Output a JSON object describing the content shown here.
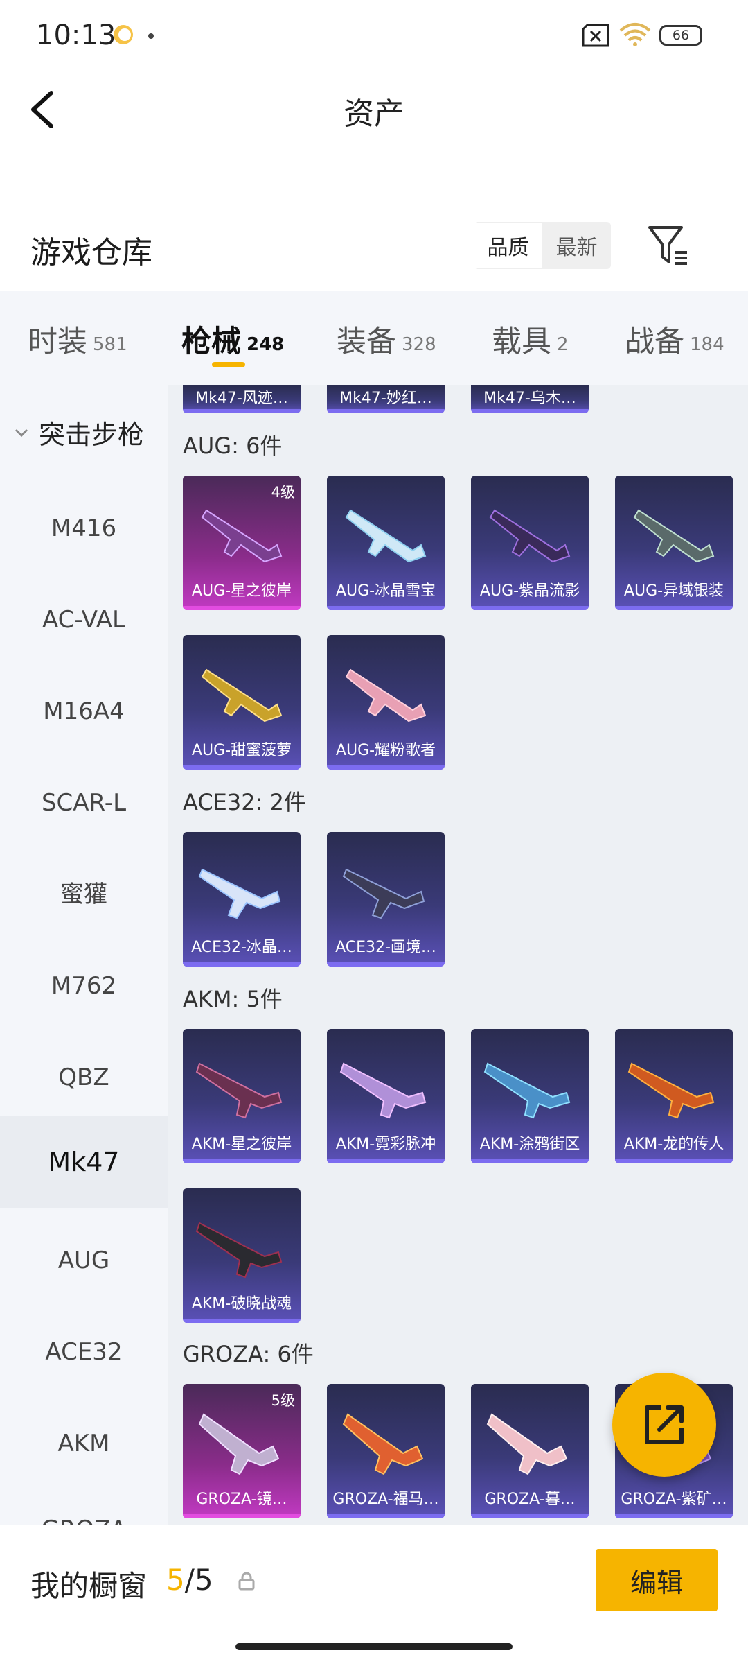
{
  "status": {
    "time": "10:13",
    "battery": "66"
  },
  "nav": {
    "title": "资产"
  },
  "warehouse": {
    "label": "游戏仓库",
    "sort_quality": "品质",
    "sort_newest": "最新"
  },
  "tabs": [
    {
      "name": "时装",
      "count": "581"
    },
    {
      "name": "枪械",
      "count": "248"
    },
    {
      "name": "装备",
      "count": "328"
    },
    {
      "name": "载具",
      "count": "2"
    },
    {
      "name": "战备",
      "count": "184"
    }
  ],
  "sidebar": {
    "category": "突击步枪",
    "items": [
      "M416",
      "AC-VAL",
      "M16A4",
      "SCAR-L",
      "蜜獾",
      "M762",
      "QBZ",
      "Mk47",
      "AUG",
      "ACE32",
      "AKM",
      "GROZA"
    ]
  },
  "top_row": [
    "Mk47-风迹…",
    "Mk47-妙红…",
    "Mk47-乌木…"
  ],
  "sections": {
    "aug": {
      "title": "AUG: 6件",
      "items": [
        "AUG-星之彼岸",
        "AUG-冰晶雪宝",
        "AUG-紫晶流影",
        "AUG-异域银装",
        "AUG-甜蜜菠萝",
        "AUG-耀粉歌者"
      ],
      "level": "4级"
    },
    "ace32": {
      "title": "ACE32: 2件",
      "items": [
        "ACE32-冰晶…",
        "ACE32-画境…"
      ]
    },
    "akm": {
      "title": "AKM: 5件",
      "items": [
        "AKM-星之彼岸",
        "AKM-霓彩脉冲",
        "AKM-涂鸦街区",
        "AKM-龙的传人",
        "AKM-破晓战魂"
      ]
    },
    "groza": {
      "title": "GROZA: 6件",
      "items": [
        "GROZA-镜…",
        "GROZA-福马…",
        "GROZA-暮…",
        "GROZA-紫矿…"
      ],
      "level": "5级"
    }
  },
  "bottom": {
    "label": "我的橱窗",
    "count_a": "5",
    "count_b": "/5",
    "edit": "编辑"
  }
}
